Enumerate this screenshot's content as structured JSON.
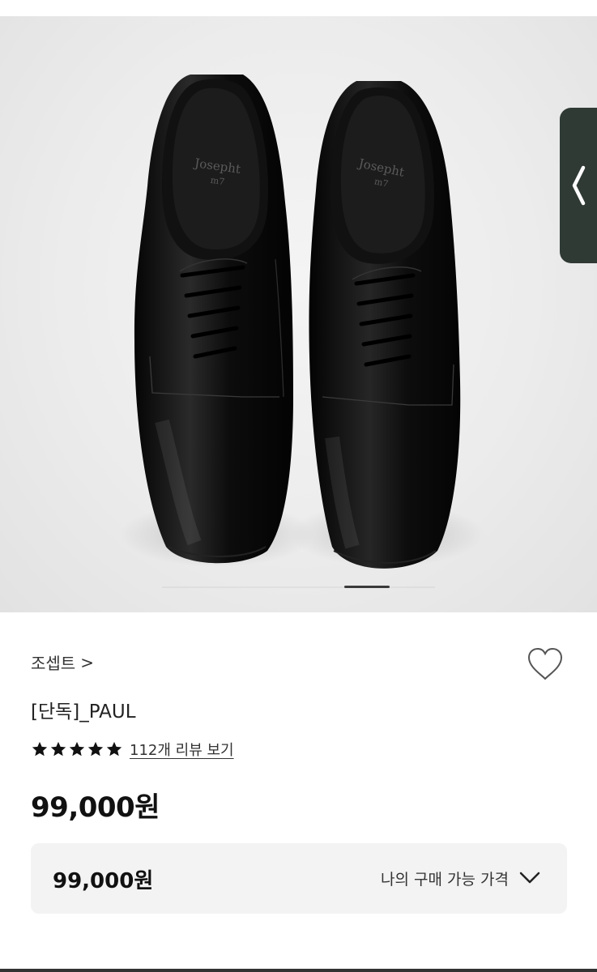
{
  "product_image": {
    "insole_brand": "Josepht",
    "slide_count_indicator": "1"
  },
  "brand": {
    "name": "조셉트",
    "chevron": ">"
  },
  "product": {
    "title": "[단독]_PAUL",
    "rating_stars": 5,
    "review_link": "112개 리뷰 보기",
    "price": "99,000원"
  },
  "price_box": {
    "price": "99,000원",
    "label": "나의 구매 가능 가격"
  },
  "icons": {
    "wishlist": "heart-outline-icon",
    "side_tab": "chevron-left-icon",
    "dropdown": "chevron-down-icon",
    "star": "star-filled-icon"
  },
  "colors": {
    "side_tab_bg": "#2f3a35",
    "price_box_bg": "#f3f3f3",
    "text_primary": "#111111"
  }
}
